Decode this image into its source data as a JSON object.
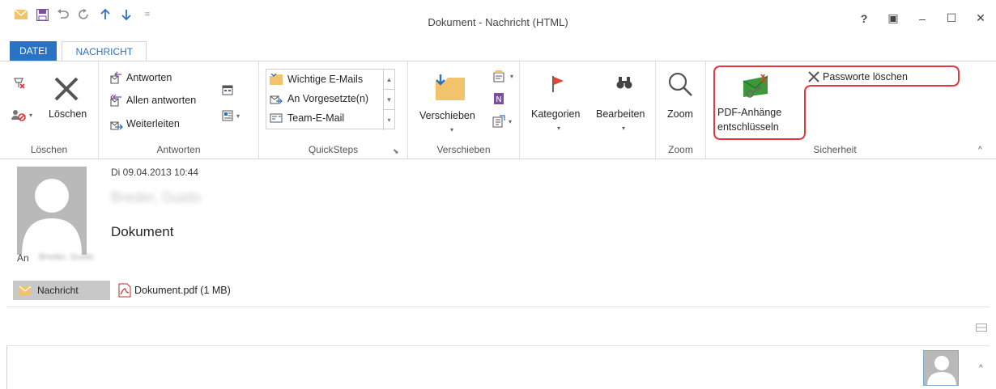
{
  "window": {
    "title": "Dokument - Nachricht (HTML)",
    "help": "?",
    "restore_ribbon": "▣",
    "minimize": "–",
    "maximize": "☐",
    "close": "✕"
  },
  "qat": {
    "dropdown": "="
  },
  "tabs": {
    "file": "DATEI",
    "message": "NACHRICHT"
  },
  "ribbon": {
    "delete_group": {
      "label": "Löschen",
      "delete_button": "Löschen"
    },
    "respond_group": {
      "label": "Antworten",
      "reply": "Antworten",
      "reply_all": "Allen antworten",
      "forward": "Weiterleiten"
    },
    "quicksteps_group": {
      "label": "QuickSteps",
      "items": [
        "Wichtige E-Mails",
        "An Vorgesetzte(n)",
        "Team-E-Mail"
      ]
    },
    "move_group": {
      "label": "Verschieben",
      "move_button": "Verschieben"
    },
    "tags_group": {
      "categories": "Kategorien",
      "edit": "Bearbeiten"
    },
    "zoom_group": {
      "label": "Zoom",
      "zoom_button": "Zoom"
    },
    "security_group": {
      "label": "Sicherheit",
      "pdf_decrypt_line1": "PDF-Anhänge",
      "pdf_decrypt_line2": "entschlüsseln",
      "delete_passwords": "Passworte löschen"
    },
    "collapse": "^"
  },
  "message": {
    "date": "Di 09.04.2013 10:44",
    "sender": "Breder, Guido",
    "subject": "Dokument",
    "to_label": "An",
    "to_value": "Breder, Guido",
    "attachments": {
      "message_tab": "Nachricht",
      "pdf": "Dokument.pdf (1 MB)"
    }
  },
  "footer": {
    "people_pane_collapse": "^"
  },
  "colors": {
    "accent": "#2a72c4",
    "highlight": "#e03a3a"
  }
}
